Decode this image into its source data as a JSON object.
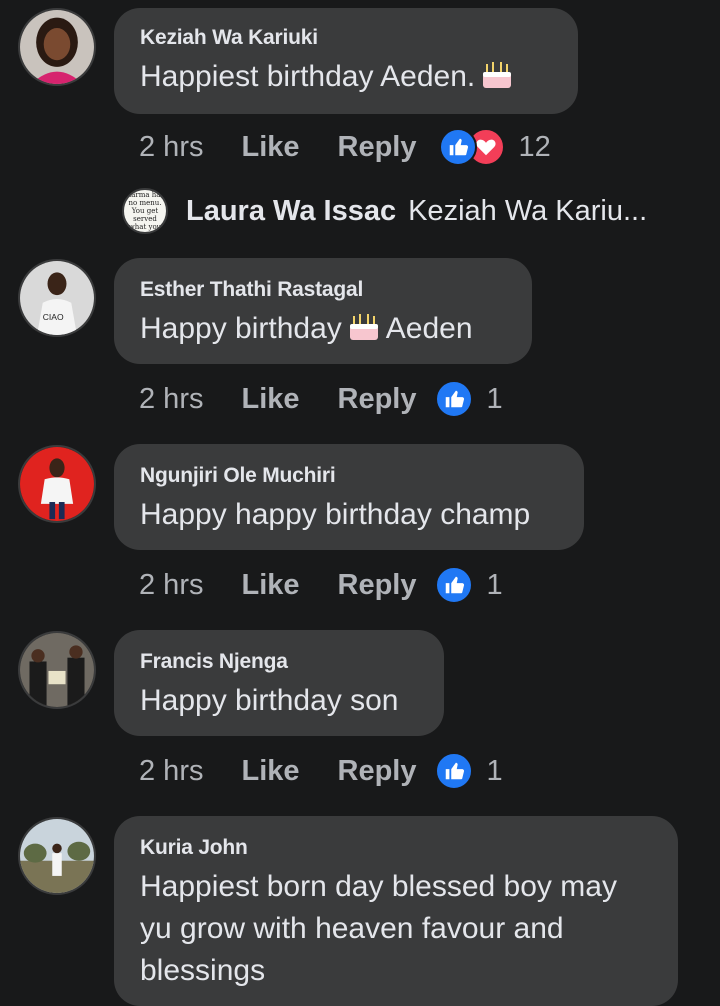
{
  "comments": [
    {
      "author": "Keziah Wa Kariuki",
      "text_before": "Happiest birthday Aeden.",
      "text_after": "",
      "time": "2 hrs",
      "like": "Like",
      "reply": "Reply",
      "reaction_count": "12",
      "reactions": [
        "like",
        "love"
      ]
    },
    {
      "author": "Esther Thathi Rastagal",
      "text_before": "Happy birthday",
      "text_after": "Aeden",
      "time": "2 hrs",
      "like": "Like",
      "reply": "Reply",
      "reaction_count": "1",
      "reactions": [
        "like"
      ]
    },
    {
      "author": "Ngunjiri Ole Muchiri",
      "text_before": "Happy happy birthday champ",
      "text_after": "",
      "time": "2 hrs",
      "like": "Like",
      "reply": "Reply",
      "reaction_count": "1",
      "reactions": [
        "like"
      ]
    },
    {
      "author": "Francis Njenga",
      "text_before": "Happy birthday son",
      "text_after": "",
      "time": "2 hrs",
      "like": "Like",
      "reply": "Reply",
      "reaction_count": "1",
      "reactions": [
        "like"
      ]
    },
    {
      "author": "Kuria John",
      "text_lines": [
        "Happiest born day blessed boy may",
        "yu grow with heaven favour and",
        "blessings"
      ]
    }
  ],
  "reply_preview": {
    "author": "Laura Wa Issac",
    "text": "Keziah Wa Kariu...",
    "avatar_text": [
      "Karma has",
      "no menu.",
      "You get",
      "served",
      "what you"
    ]
  },
  "icons": {
    "like": "thumbs-up-icon",
    "love": "heart-icon",
    "cake": "birthday-cake-emoji"
  },
  "colors": {
    "background": "#18191a",
    "bubble": "#3a3b3c",
    "like_blue": "#2078f4",
    "love_red": "#f33e58"
  }
}
